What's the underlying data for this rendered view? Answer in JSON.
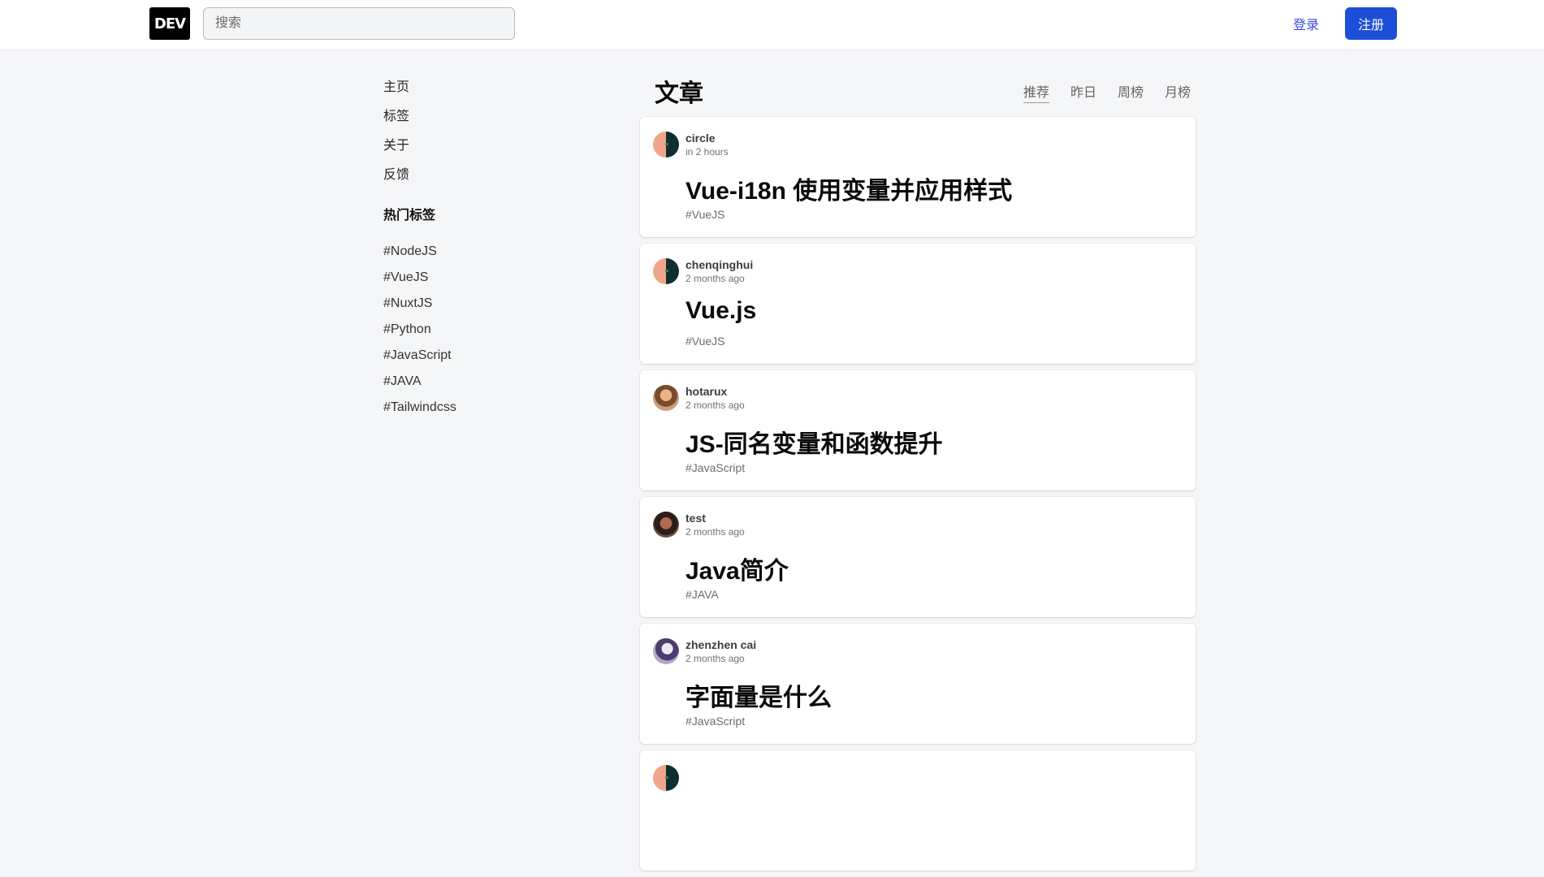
{
  "header": {
    "logo_text": "DEV",
    "search_placeholder": "搜索",
    "login_label": "登录",
    "signup_label": "注册",
    "accent_color": "#1d4ed8"
  },
  "sidebar": {
    "nav_items": [
      {
        "label": "主页"
      },
      {
        "label": "标签"
      },
      {
        "label": "关于"
      },
      {
        "label": "反馈"
      }
    ],
    "hot_tags_title": "热门标签",
    "hot_tags": [
      "#NodeJS",
      "#VueJS",
      "#NuxtJS",
      "#Python",
      "#JavaScript",
      "#JAVA",
      "#Tailwindcss"
    ]
  },
  "feed": {
    "title": "文章",
    "tabs": [
      "推荐",
      "昨日",
      "周榜",
      "月榜"
    ],
    "active_tab": "推荐",
    "articles": [
      {
        "author": "circle",
        "time": "in 2 hours",
        "title": "Vue-i18n 使用变量并应用样式",
        "tag": "#VueJS"
      },
      {
        "author": "chenqinghui",
        "time": "2 months ago",
        "title": "Vue.js",
        "tag": "#VueJS"
      },
      {
        "author": "hotarux",
        "time": "2 months ago",
        "title": "JS-同名变量和函数提升",
        "tag": "#JavaScript"
      },
      {
        "author": "test",
        "time": "2 months ago",
        "title": "Java简介",
        "tag": "#JAVA"
      },
      {
        "author": "zhenzhen cai",
        "time": "2 months ago",
        "title": "字面量是什么",
        "tag": "#JavaScript"
      }
    ]
  }
}
